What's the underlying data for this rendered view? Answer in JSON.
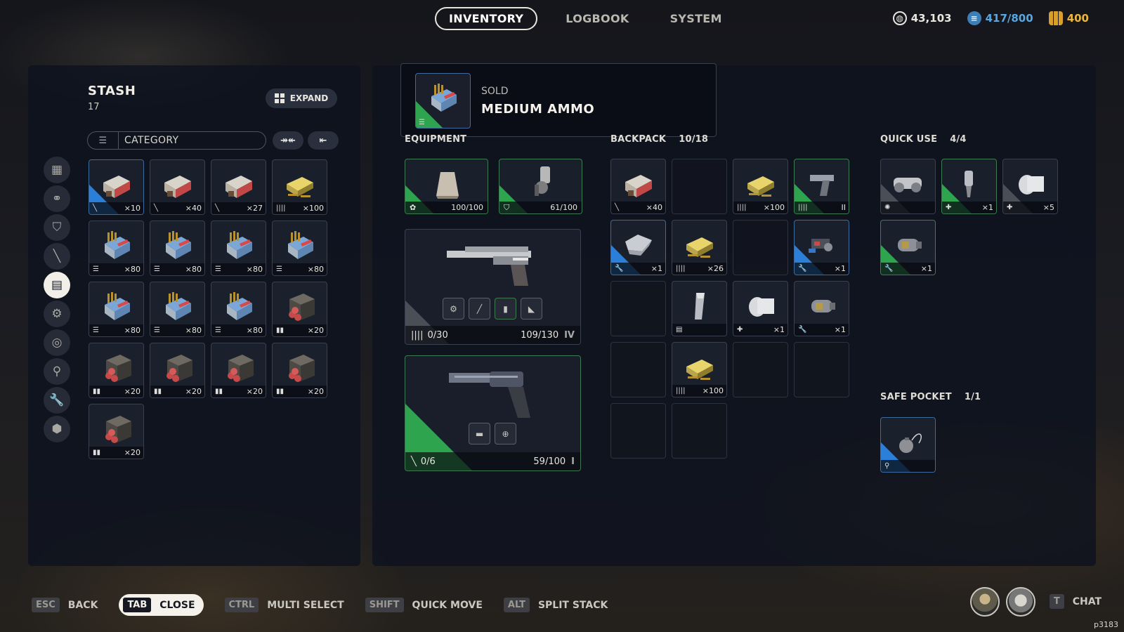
{
  "nav": {
    "tabs": [
      {
        "label": "INVENTORY",
        "active": true
      },
      {
        "label": "LOGBOOK",
        "active": false
      },
      {
        "label": "SYSTEM",
        "active": false
      }
    ]
  },
  "currencies": {
    "credits": "43,103",
    "capacity": "417/800",
    "tokens": "400"
  },
  "stash": {
    "title": "STASH",
    "count": "17",
    "expand_label": "EXPAND",
    "category_label": "CATEGORY",
    "categories": [
      "grid-icon",
      "items-icon",
      "shield-icon",
      "blade-icon",
      "ammo-icon",
      "mods-icon",
      "ring-icon",
      "tool-icon",
      "wrench-icon",
      "box-icon"
    ],
    "active_category": 4,
    "items": [
      {
        "name": "ammo-crate-red",
        "qty": "×10",
        "type": "blade",
        "rarity": "blue"
      },
      {
        "name": "ammo-crate-red",
        "qty": "×40",
        "type": "blade",
        "rarity": "none"
      },
      {
        "name": "ammo-crate-red",
        "qty": "×27",
        "type": "blade",
        "rarity": "none"
      },
      {
        "name": "ammo-box-yellow",
        "qty": "×100",
        "type": "light",
        "rarity": "none"
      },
      {
        "name": "medium-ammo",
        "qty": "×80",
        "type": "medium",
        "rarity": "none"
      },
      {
        "name": "medium-ammo",
        "qty": "×80",
        "type": "medium",
        "rarity": "none"
      },
      {
        "name": "medium-ammo",
        "qty": "×80",
        "type": "medium",
        "rarity": "none"
      },
      {
        "name": "medium-ammo",
        "qty": "×80",
        "type": "medium",
        "rarity": "none"
      },
      {
        "name": "medium-ammo",
        "qty": "×80",
        "type": "medium",
        "rarity": "none"
      },
      {
        "name": "medium-ammo",
        "qty": "×80",
        "type": "medium",
        "rarity": "none"
      },
      {
        "name": "medium-ammo",
        "qty": "×80",
        "type": "medium",
        "rarity": "none"
      },
      {
        "name": "shotgun-shells",
        "qty": "×20",
        "type": "heavy",
        "rarity": "none"
      },
      {
        "name": "shotgun-shells",
        "qty": "×20",
        "type": "heavy",
        "rarity": "none"
      },
      {
        "name": "shotgun-shells",
        "qty": "×20",
        "type": "heavy",
        "rarity": "none"
      },
      {
        "name": "shotgun-shells",
        "qty": "×20",
        "type": "heavy",
        "rarity": "none"
      },
      {
        "name": "shotgun-shells",
        "qty": "×20",
        "type": "heavy",
        "rarity": "none"
      },
      {
        "name": "shotgun-shells",
        "qty": "×20",
        "type": "heavy",
        "rarity": "none"
      }
    ]
  },
  "sold": {
    "label": "SOLD",
    "item_name": "MEDIUM AMMO"
  },
  "equipment": {
    "label": "EQUIPMENT",
    "augment": {
      "value": "100/100"
    },
    "shield": {
      "value": "61/100"
    },
    "weapon1": {
      "ammo": "0/30",
      "durability": "109/130",
      "tier": "IV"
    },
    "weapon2": {
      "ammo": "0/6",
      "durability": "59/100",
      "tier": "I"
    }
  },
  "backpack": {
    "label": "BACKPACK",
    "count": "10/18",
    "items": [
      {
        "art": "crate",
        "qty": "×40",
        "type": "blade",
        "rarity": "none"
      },
      {
        "art": "",
        "qty": "",
        "type": "",
        "rarity": "empty"
      },
      {
        "art": "yellow",
        "qty": "×100",
        "type": "light",
        "rarity": "none"
      },
      {
        "art": "pistol",
        "qty": "II",
        "type": "light",
        "rarity": "green"
      },
      {
        "art": "bag",
        "qty": "×1",
        "type": "wrench",
        "rarity": "blue"
      },
      {
        "art": "yellow",
        "qty": "×26",
        "type": "light",
        "rarity": "none"
      },
      {
        "art": "",
        "qty": "",
        "type": "",
        "rarity": "empty"
      },
      {
        "art": "parts",
        "qty": "×1",
        "type": "wrench",
        "rarity": "blue"
      },
      {
        "art": "",
        "qty": "",
        "type": "",
        "rarity": "empty"
      },
      {
        "art": "stick",
        "qty": "",
        "type": "doc",
        "rarity": "none"
      },
      {
        "art": "bandage",
        "qty": "×1",
        "type": "heal",
        "rarity": "none"
      },
      {
        "art": "canister",
        "qty": "×1",
        "type": "wrench",
        "rarity": "none"
      },
      {
        "art": "",
        "qty": "",
        "type": "",
        "rarity": "empty"
      },
      {
        "art": "yellow",
        "qty": "×100",
        "type": "light",
        "rarity": "none"
      },
      {
        "art": "",
        "qty": "",
        "type": "",
        "rarity": "empty"
      },
      {
        "art": "",
        "qty": "",
        "type": "",
        "rarity": "empty"
      },
      {
        "art": "",
        "qty": "",
        "type": "",
        "rarity": "empty"
      },
      {
        "art": "",
        "qty": "",
        "type": "",
        "rarity": "empty"
      }
    ]
  },
  "quick_use": {
    "label": "QUICK USE",
    "count": "4/4",
    "items": [
      {
        "art": "binoculars",
        "qty": "",
        "type": "gear",
        "rarity": "grey"
      },
      {
        "art": "injector",
        "qty": "×1",
        "type": "heal",
        "rarity": "green"
      },
      {
        "art": "bandage",
        "qty": "×5",
        "type": "heal",
        "rarity": "grey"
      },
      {
        "art": "canister",
        "qty": "×1",
        "type": "wrench",
        "rarity": "green"
      }
    ]
  },
  "safe_pocket": {
    "label": "SAFE POCKET",
    "count": "1/1",
    "item": {
      "art": "grenade",
      "type": "tool",
      "rarity": "blue"
    }
  },
  "hints": [
    {
      "key": "ESC",
      "label": "BACK"
    },
    {
      "key": "TAB",
      "label": "CLOSE"
    },
    {
      "key": "CTRL",
      "label": "MULTI SELECT"
    },
    {
      "key": "SHIFT",
      "label": "QUICK MOVE"
    },
    {
      "key": "ALT",
      "label": "SPLIT STACK"
    }
  ],
  "chat": {
    "key": "T",
    "label": "CHAT"
  },
  "player_id": "p3183"
}
